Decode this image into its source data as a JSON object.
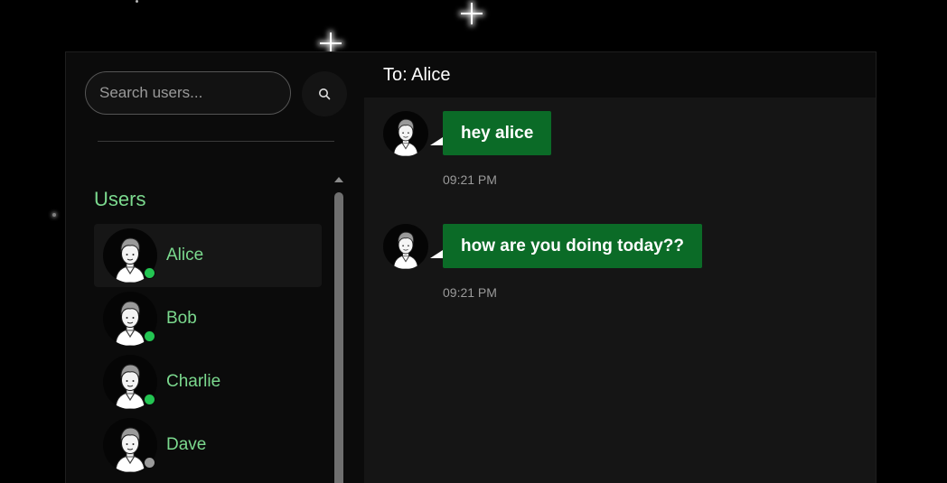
{
  "search": {
    "placeholder": "Search users..."
  },
  "icons": {
    "search_button": "search-icon"
  },
  "sidebar": {
    "heading": "Users",
    "users": [
      {
        "name": "Alice",
        "online": true,
        "active": true
      },
      {
        "name": "Bob",
        "online": true,
        "active": false
      },
      {
        "name": "Charlie",
        "online": true,
        "active": false
      },
      {
        "name": "Dave",
        "online": false,
        "active": false
      }
    ]
  },
  "chat": {
    "header": "To: Alice",
    "messages": [
      {
        "text": "hey alice",
        "time": "09:21 PM"
      },
      {
        "text": "how are you doing today??",
        "time": "09:21 PM"
      }
    ]
  },
  "colors": {
    "accent_text": "#7bd98e",
    "online": "#23c552",
    "offline": "#9a9a9a",
    "bubble": "#0b6b27",
    "background": "#000000"
  }
}
